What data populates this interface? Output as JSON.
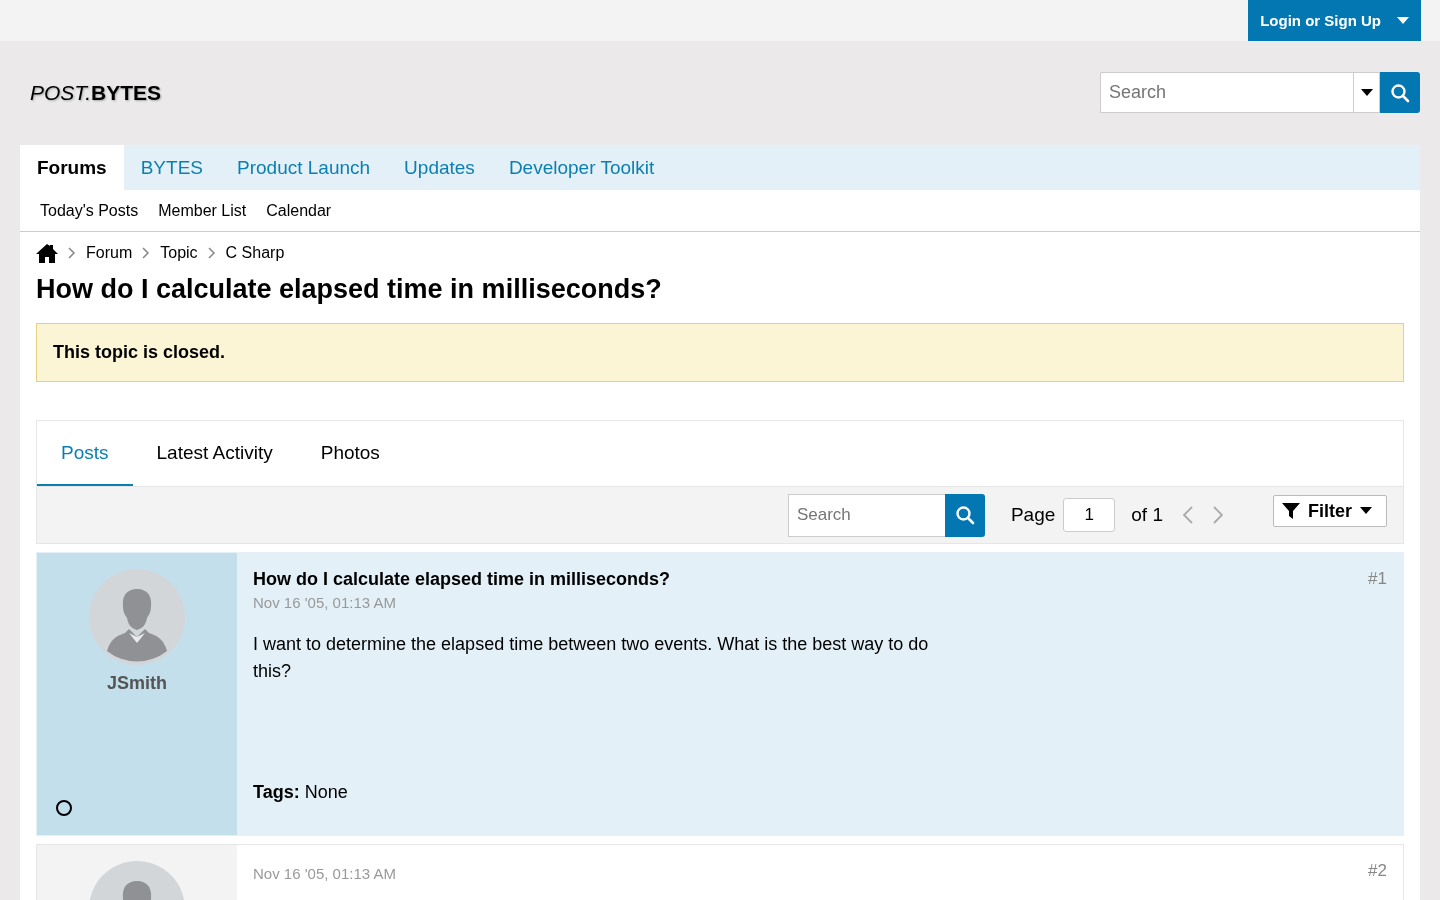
{
  "top_bar": {
    "login_button": "Login or Sign Up"
  },
  "header": {
    "logo": {
      "prefix": "POST.",
      "name": "BYTES"
    },
    "search": {
      "placeholder": "Search"
    }
  },
  "nav_tabs": [
    {
      "label": "Forums",
      "selected": true
    },
    {
      "label": "BYTES",
      "selected": false
    },
    {
      "label": "Product Launch",
      "selected": false
    },
    {
      "label": "Updates",
      "selected": false
    },
    {
      "label": "Developer Toolkit",
      "selected": false
    }
  ],
  "sub_nav": [
    "Today's Posts",
    "Member List",
    "Calendar"
  ],
  "breadcrumb": [
    "Forum",
    "Topic",
    "C Sharp"
  ],
  "page_title": "How do I calculate elapsed time in milliseconds?",
  "notice": "This topic is closed.",
  "topic_tabs": [
    {
      "label": "Posts",
      "selected": true
    },
    {
      "label": "Latest Activity",
      "selected": false
    },
    {
      "label": "Photos",
      "selected": false
    }
  ],
  "toolbar": {
    "search": {
      "placeholder": "Search"
    },
    "page_label": "Page",
    "page_value": "1",
    "page_total": "of 1",
    "filter_button": "Filter"
  },
  "posts": [
    {
      "starter": true,
      "username": "JSmith",
      "online": false,
      "title": "How do I calculate elapsed time in milliseconds?",
      "date": "Nov 16 '05, 01:13 AM",
      "number": "#1",
      "body": "I want to determine the elapsed time between two events. What is the best way to do this?",
      "tags": "**Tags:** None"
    },
    {
      "starter": false,
      "date": "Nov 16 '05, 01:13 AM",
      "number": "#2"
    }
  ]
}
